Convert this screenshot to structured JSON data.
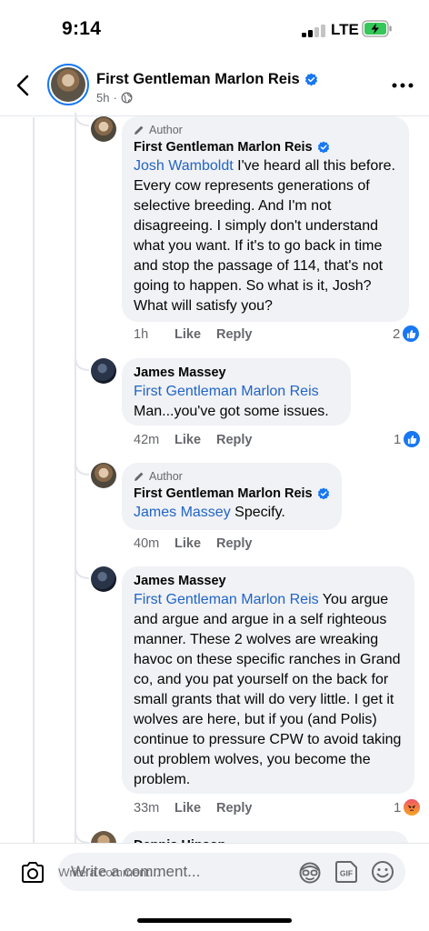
{
  "status_bar": {
    "time": "9:14",
    "network": "LTE"
  },
  "header": {
    "name": "First Gentleman Marlon Reis",
    "time_ago": "5h",
    "separator": "·"
  },
  "author_label": "Author",
  "comments": [
    {
      "author": "First Gentleman Marlon Reis",
      "is_author": true,
      "verified": true,
      "mention": "Josh Wamboldt",
      "text": " I've heard all this before. Every cow represents generations of selective breeding. And I'm not disagreeing. I simply don't understand what you want. If it's to go back in time and stop the passage of 114, that's not going to happen. So what is it, Josh? What will satisfy you?",
      "time": "1h",
      "like_label": "Like",
      "reply_label": "Reply",
      "reaction_count": "2",
      "reaction": "like"
    },
    {
      "author": "James Massey",
      "is_author": false,
      "verified": false,
      "mention": "First Gentleman Marlon Reis",
      "text": "Man...you've got some issues.",
      "time": "42m",
      "like_label": "Like",
      "reply_label": "Reply",
      "reaction_count": "1",
      "reaction": "like"
    },
    {
      "author": "First Gentleman Marlon Reis",
      "is_author": true,
      "verified": true,
      "mention": "James Massey",
      "text": " Specify.",
      "time": "40m",
      "like_label": "Like",
      "reply_label": "Reply"
    },
    {
      "author": "James Massey",
      "is_author": false,
      "verified": false,
      "mention": "First Gentleman Marlon Reis",
      "text": " You argue and argue and argue in a self righteous manner. These 2 wolves are wreaking havoc on these specific ranches in Grand co, and you pat yourself on the back for small grants that will do very little. I get it wolves are here, but if you (and Polis) continue to pressure CPW to avoid taking out problem wolves, you become the problem.",
      "time": "33m",
      "like_label": "Like",
      "reply_label": "Reply",
      "reaction_count": "1",
      "reaction": "angry"
    },
    {
      "author": "Dennis Hinson"
    }
  ],
  "composer": {
    "placeholder": "Write a comment..."
  },
  "colors": {
    "accent": "#1877f2",
    "mention": "#2264c6",
    "bubble": "#f0f2f5",
    "meta": "#65676b"
  },
  "icons": [
    "back-arrow-icon",
    "verified-badge-icon",
    "globe-icon",
    "more-icon",
    "pencil-icon",
    "like-reaction-icon",
    "angry-reaction-icon",
    "camera-icon",
    "avatar-sticker-icon",
    "gif-icon",
    "emoji-icon"
  ]
}
